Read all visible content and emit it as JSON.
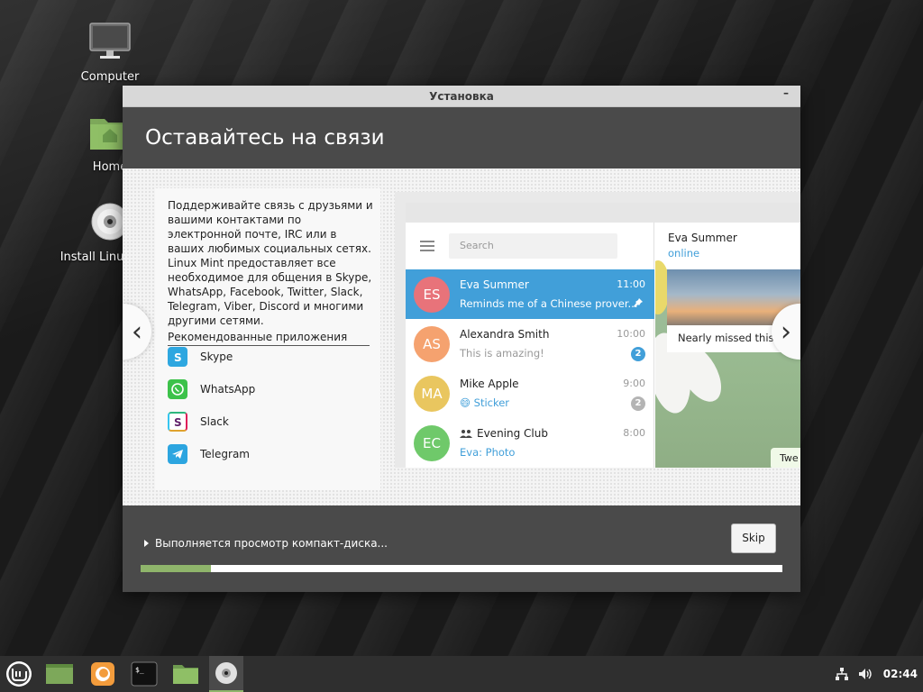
{
  "desktop": {
    "icons": [
      {
        "label": "Computer"
      },
      {
        "label": "Home"
      },
      {
        "label": "Install Linux Mint"
      }
    ]
  },
  "window": {
    "title": "Установка",
    "minimize_glyph": "–",
    "header_title": "Оставайтесь на связи",
    "description": "Поддерживайте связь с друзьями и вашими контактами по электронной почте, IRC или в ваших любимых социальных сетях. Linux Mint предоставляет все необходимое для общения в Skype, WhatsApp, Facebook, Twitter, Slack, Telegram, Viber, Discord и многими другими сетями.",
    "recommended_title": "Рекомендованные приложения",
    "apps": [
      {
        "label": "Skype",
        "color": "#2ea7e0"
      },
      {
        "label": "WhatsApp",
        "color": "#3cc24a"
      },
      {
        "label": "Slack",
        "color": "#611f69"
      },
      {
        "label": "Telegram",
        "color": "#2ca5e0"
      }
    ],
    "nav_prev": "‹",
    "nav_next": "›"
  },
  "telegram": {
    "search_placeholder": "Search",
    "chats": [
      {
        "initials": "ES",
        "name": "Eva Summer",
        "time": "11:00",
        "message": "Reminds me of a Chinese prover...",
        "color": "#e8737a",
        "active": true
      },
      {
        "initials": "AS",
        "name": "Alexandra Smith",
        "time": "10:00",
        "message": "This is amazing!",
        "badge": "2",
        "color": "#f5a26f"
      },
      {
        "initials": "MA",
        "name": "Mike Apple",
        "time": "9:00",
        "message": "😄 Sticker",
        "badge": "2",
        "color": "#e9c65f"
      },
      {
        "initials": "EC",
        "name": "Evening Club",
        "time": "8:00",
        "message": "Eva: Photo",
        "color": "#6fc96a"
      }
    ],
    "contact_name": "Eva Summer",
    "contact_status": "online",
    "photo_caption": "Nearly missed this s",
    "bubble_text": "Twe"
  },
  "footer": {
    "status_text": "Выполняется просмотр компакт-диска...",
    "skip_label": "Skip",
    "progress": 0.11
  },
  "taskbar": {
    "clock": "02:44"
  },
  "colors": {
    "accent": "#8fb56b",
    "header_bg": "#4a4a4a",
    "telegram_blue": "#419fd9"
  }
}
